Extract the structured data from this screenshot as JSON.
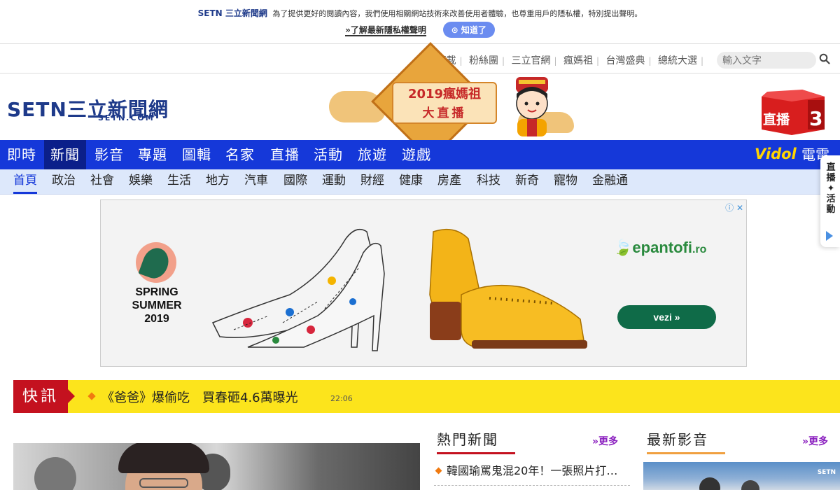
{
  "cookie_bar": {
    "brand": "SETN 三立新聞網",
    "message": "為了提供更好的閱讀內容，我們使用相關網站技術來改善使用者體驗，也尊重用戶的隱私權，特別提出聲明。",
    "privacy_link": "»了解最新隱私權聲明",
    "ok_button": "知道了"
  },
  "utility_nav": {
    "links": [
      "APP下載",
      "粉絲團",
      "三立官網",
      "瘋媽祖",
      "台灣盛典",
      "總統大選"
    ],
    "search_placeholder": "輸入文字"
  },
  "logo": {
    "text": "SETN三立新聞網",
    "sub": "SETN.COM"
  },
  "banner": {
    "line1": "2019瘋媽祖",
    "line2": "大直播"
  },
  "live_badge": {
    "label": "直播",
    "channel": "3"
  },
  "main_nav": {
    "items": [
      "即時",
      "新聞",
      "影音",
      "專題",
      "圖輯",
      "名家",
      "直播",
      "活動",
      "旅遊",
      "遊戲"
    ],
    "active": "新聞",
    "vidol": "Vidol",
    "tv_buy": "電電購"
  },
  "sub_nav": {
    "items": [
      "首頁",
      "政治",
      "社會",
      "娛樂",
      "生活",
      "地方",
      "汽車",
      "國際",
      "運動",
      "財經",
      "健康",
      "房產",
      "科技",
      "新奇",
      "寵物",
      "金融通"
    ],
    "active": "首頁"
  },
  "ad": {
    "season": "SPRING\nSUMMER\n2019",
    "brand": "epantofi",
    "brand_suffix": ".ro",
    "cta": "vezi »",
    "info": "ⓘ ✕"
  },
  "breaking": {
    "label": "快訊",
    "headline": "《爸爸》爆偷吃　買春砸4.6萬曝光",
    "time": "22:06"
  },
  "hot_news": {
    "title": "熱門新聞",
    "more": "»更多",
    "items": [
      "韓國瑜罵鬼混20年！一張照片打…"
    ]
  },
  "latest_video": {
    "title": "最新影音",
    "more": "»更多"
  },
  "side_tab": {
    "label": "直播✦活動"
  },
  "colors": {
    "brand_blue": "#1538d9",
    "nav_active": "#0b1f8a",
    "ticker_yellow": "#fce41c",
    "ticker_red": "#c4111f",
    "more_purple": "#8a1fbf"
  }
}
